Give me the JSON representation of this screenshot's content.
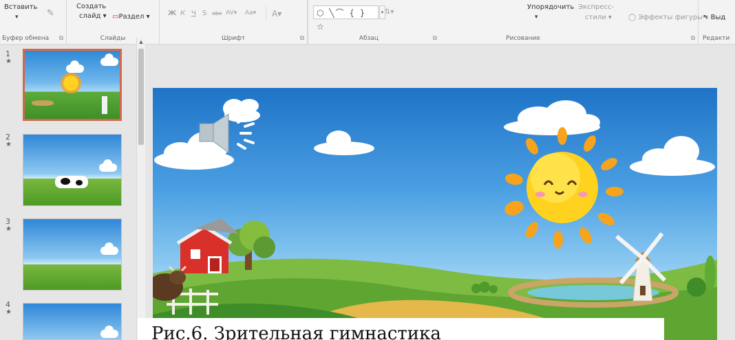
{
  "ribbon": {
    "paste_label": "Вставить",
    "new_slide_line1": "Создать",
    "new_slide_line2": "слайд",
    "section_label": "Раздел",
    "groups": {
      "clipboard": "Буфер обмена",
      "slides": "Слайды",
      "font": "Шрифт",
      "paragraph": "Абзац",
      "drawing": "Рисование",
      "editing": "Редакти"
    },
    "font_buttons": [
      "Ж",
      "К",
      "Ч",
      "S",
      "abc",
      "AV",
      "Aa",
      "A"
    ],
    "arrange_label": "Упорядочить",
    "quick_styles_line1": "Экспресс-",
    "quick_styles_line2": "стили",
    "shape_effects_label": "Эффекты фигуры",
    "select_label": "Выд",
    "shapes_gallery": "⬡ ╲⌒ { } ☆"
  },
  "thumbnails": [
    {
      "number": "1",
      "star": "★"
    },
    {
      "number": "2",
      "star": "★"
    },
    {
      "number": "3",
      "star": "★"
    },
    {
      "number": "4",
      "star": "★"
    }
  ],
  "caption": "Рис.6. Зрительная гимнастика",
  "colors": {
    "active_thumb_border": "#d2694c",
    "sun": "#ffd21f",
    "sun_ray": "#f7a41c",
    "barn": "#d9302a",
    "sky_top": "#1f73c7"
  },
  "icons": {
    "speaker": "speaker-icon"
  }
}
